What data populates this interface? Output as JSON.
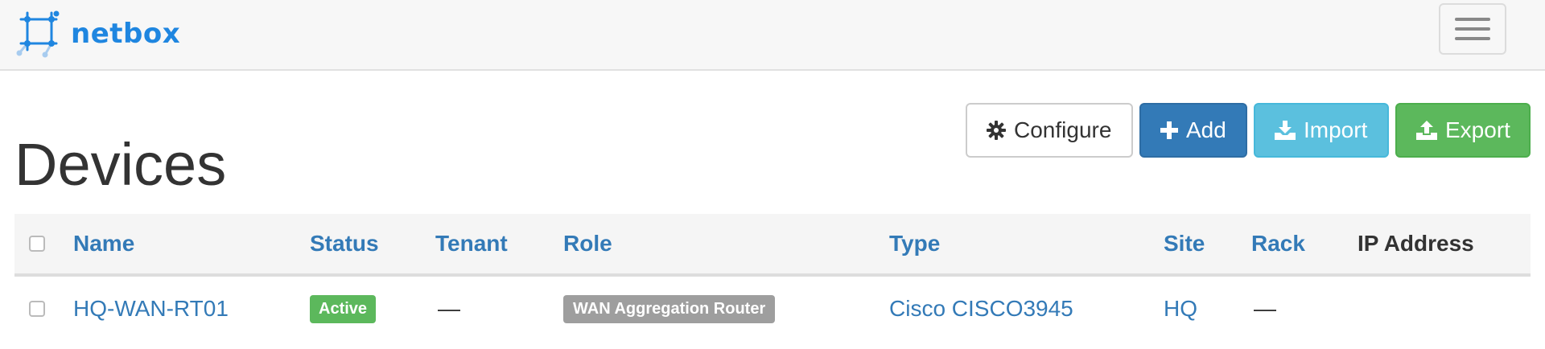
{
  "brand": {
    "name": "netbox",
    "color": "#1f86e0"
  },
  "page": {
    "title": "Devices"
  },
  "actions": {
    "configure": {
      "label": "Configure",
      "icon": "gear-icon"
    },
    "add": {
      "label": "Add",
      "icon": "plus-icon"
    },
    "import": {
      "label": "Import",
      "icon": "import-icon"
    },
    "export": {
      "label": "Export",
      "icon": "export-icon"
    }
  },
  "table": {
    "columns": [
      "Name",
      "Status",
      "Tenant",
      "Role",
      "Type",
      "Site",
      "Rack",
      "IP Address"
    ],
    "rows": [
      {
        "name": "HQ-WAN-RT01",
        "status": "Active",
        "tenant": "—",
        "role": "WAN Aggregation Router",
        "type": "Cisco CISCO3945",
        "site": "HQ",
        "rack": "—",
        "ip_address": ""
      }
    ]
  },
  "colors": {
    "link": "#337ab7",
    "status_active": "#5cb85c",
    "role_badge": "#9e9e9e",
    "btn_primary": "#337ab7",
    "btn_info": "#5bc0de",
    "btn_success": "#5cb85c"
  }
}
